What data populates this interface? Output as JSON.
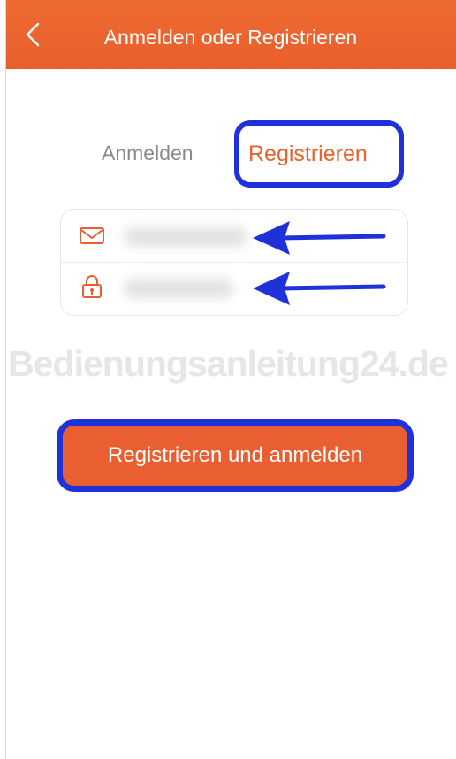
{
  "header": {
    "title": "Anmelden oder Registrieren",
    "back_icon": "chevron-left-icon"
  },
  "tabs": {
    "login": "Anmelden",
    "register": "Registrieren",
    "active": "register"
  },
  "form": {
    "email": {
      "icon": "mail-icon",
      "value": "",
      "placeholder": ""
    },
    "password": {
      "icon": "lock-icon",
      "value": "",
      "placeholder": ""
    }
  },
  "watermark": {
    "text": "Bedienungsanleitung24.de"
  },
  "actions": {
    "submit_label": "Registrieren und anmelden"
  },
  "colors": {
    "header": "#ea6130",
    "accent": "#ea5f31",
    "highlight": "#1f31d9",
    "tab_inactive": "#8a8a8a"
  }
}
